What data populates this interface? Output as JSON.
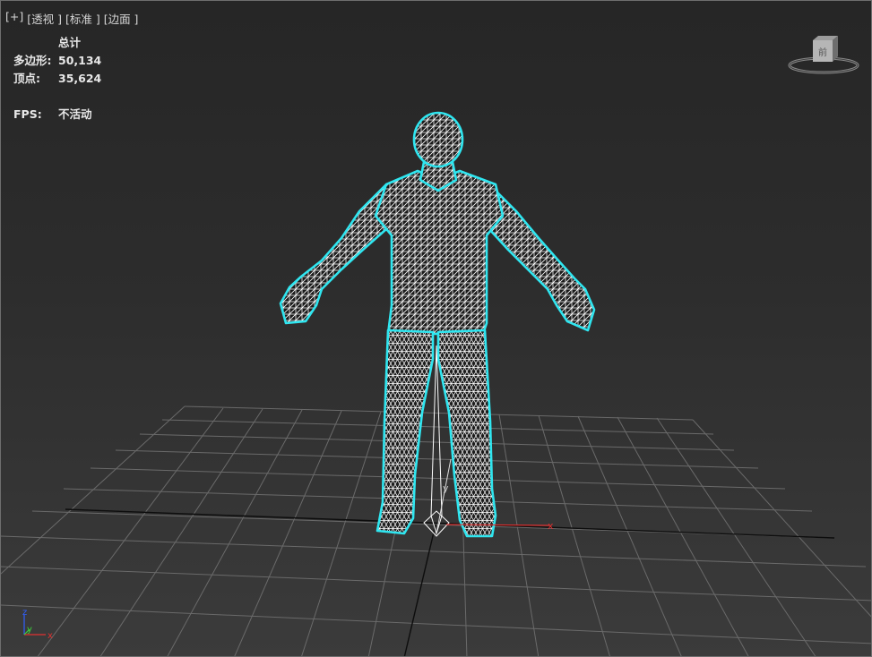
{
  "viewport_menu": {
    "plus": "[+]",
    "view": "[透视 ]",
    "shading": "[标准 ]",
    "display": "[边面 ]"
  },
  "stats": {
    "header": "总计",
    "polygons_label": "多边形:",
    "polygons_value": "50,134",
    "vertices_label": "顶点:",
    "vertices_value": "35,624",
    "fps_label": "FPS:",
    "fps_value": "不活动"
  },
  "viewcube": {
    "face_label": "前"
  },
  "axes": {
    "x": "x",
    "y": "y",
    "z": "z"
  },
  "colors": {
    "wire": "#ffffff",
    "selection_outline": "#2fe6f0",
    "x_axis": "#e03030",
    "y_axis": "#3ad13a",
    "z_axis": "#3060ff",
    "grid": "#6a6a6a"
  },
  "icons": {
    "viewcube": "viewcube-icon",
    "axis_tripod": "axis-tripod-icon",
    "pivot_gizmo": "transform-gizmo-icon"
  }
}
